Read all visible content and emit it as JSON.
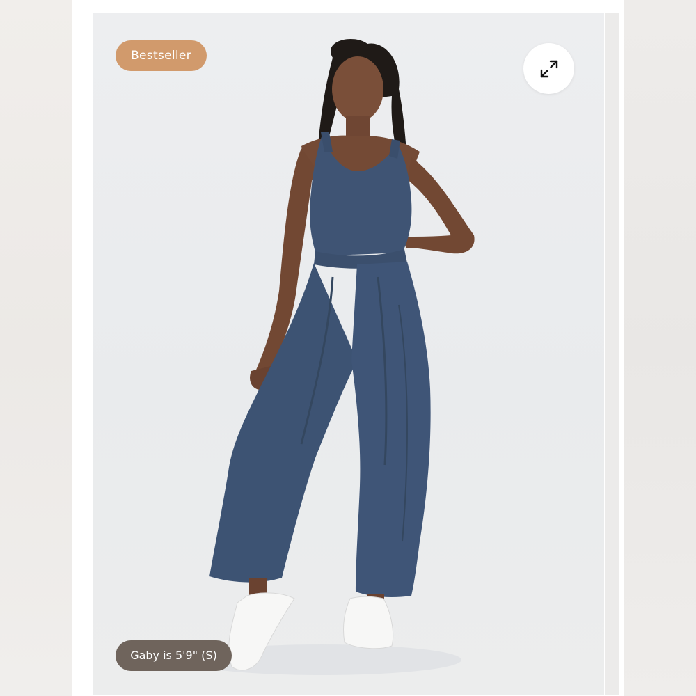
{
  "product": {
    "badge": "Bestseller",
    "model_info": "Gaby is 5'9\" (S)",
    "garment_color": "#3f5474",
    "badge_color": "#d19a6c",
    "pill_color": "#6f645c"
  },
  "icons": {
    "expand": "expand-arrows-icon"
  }
}
